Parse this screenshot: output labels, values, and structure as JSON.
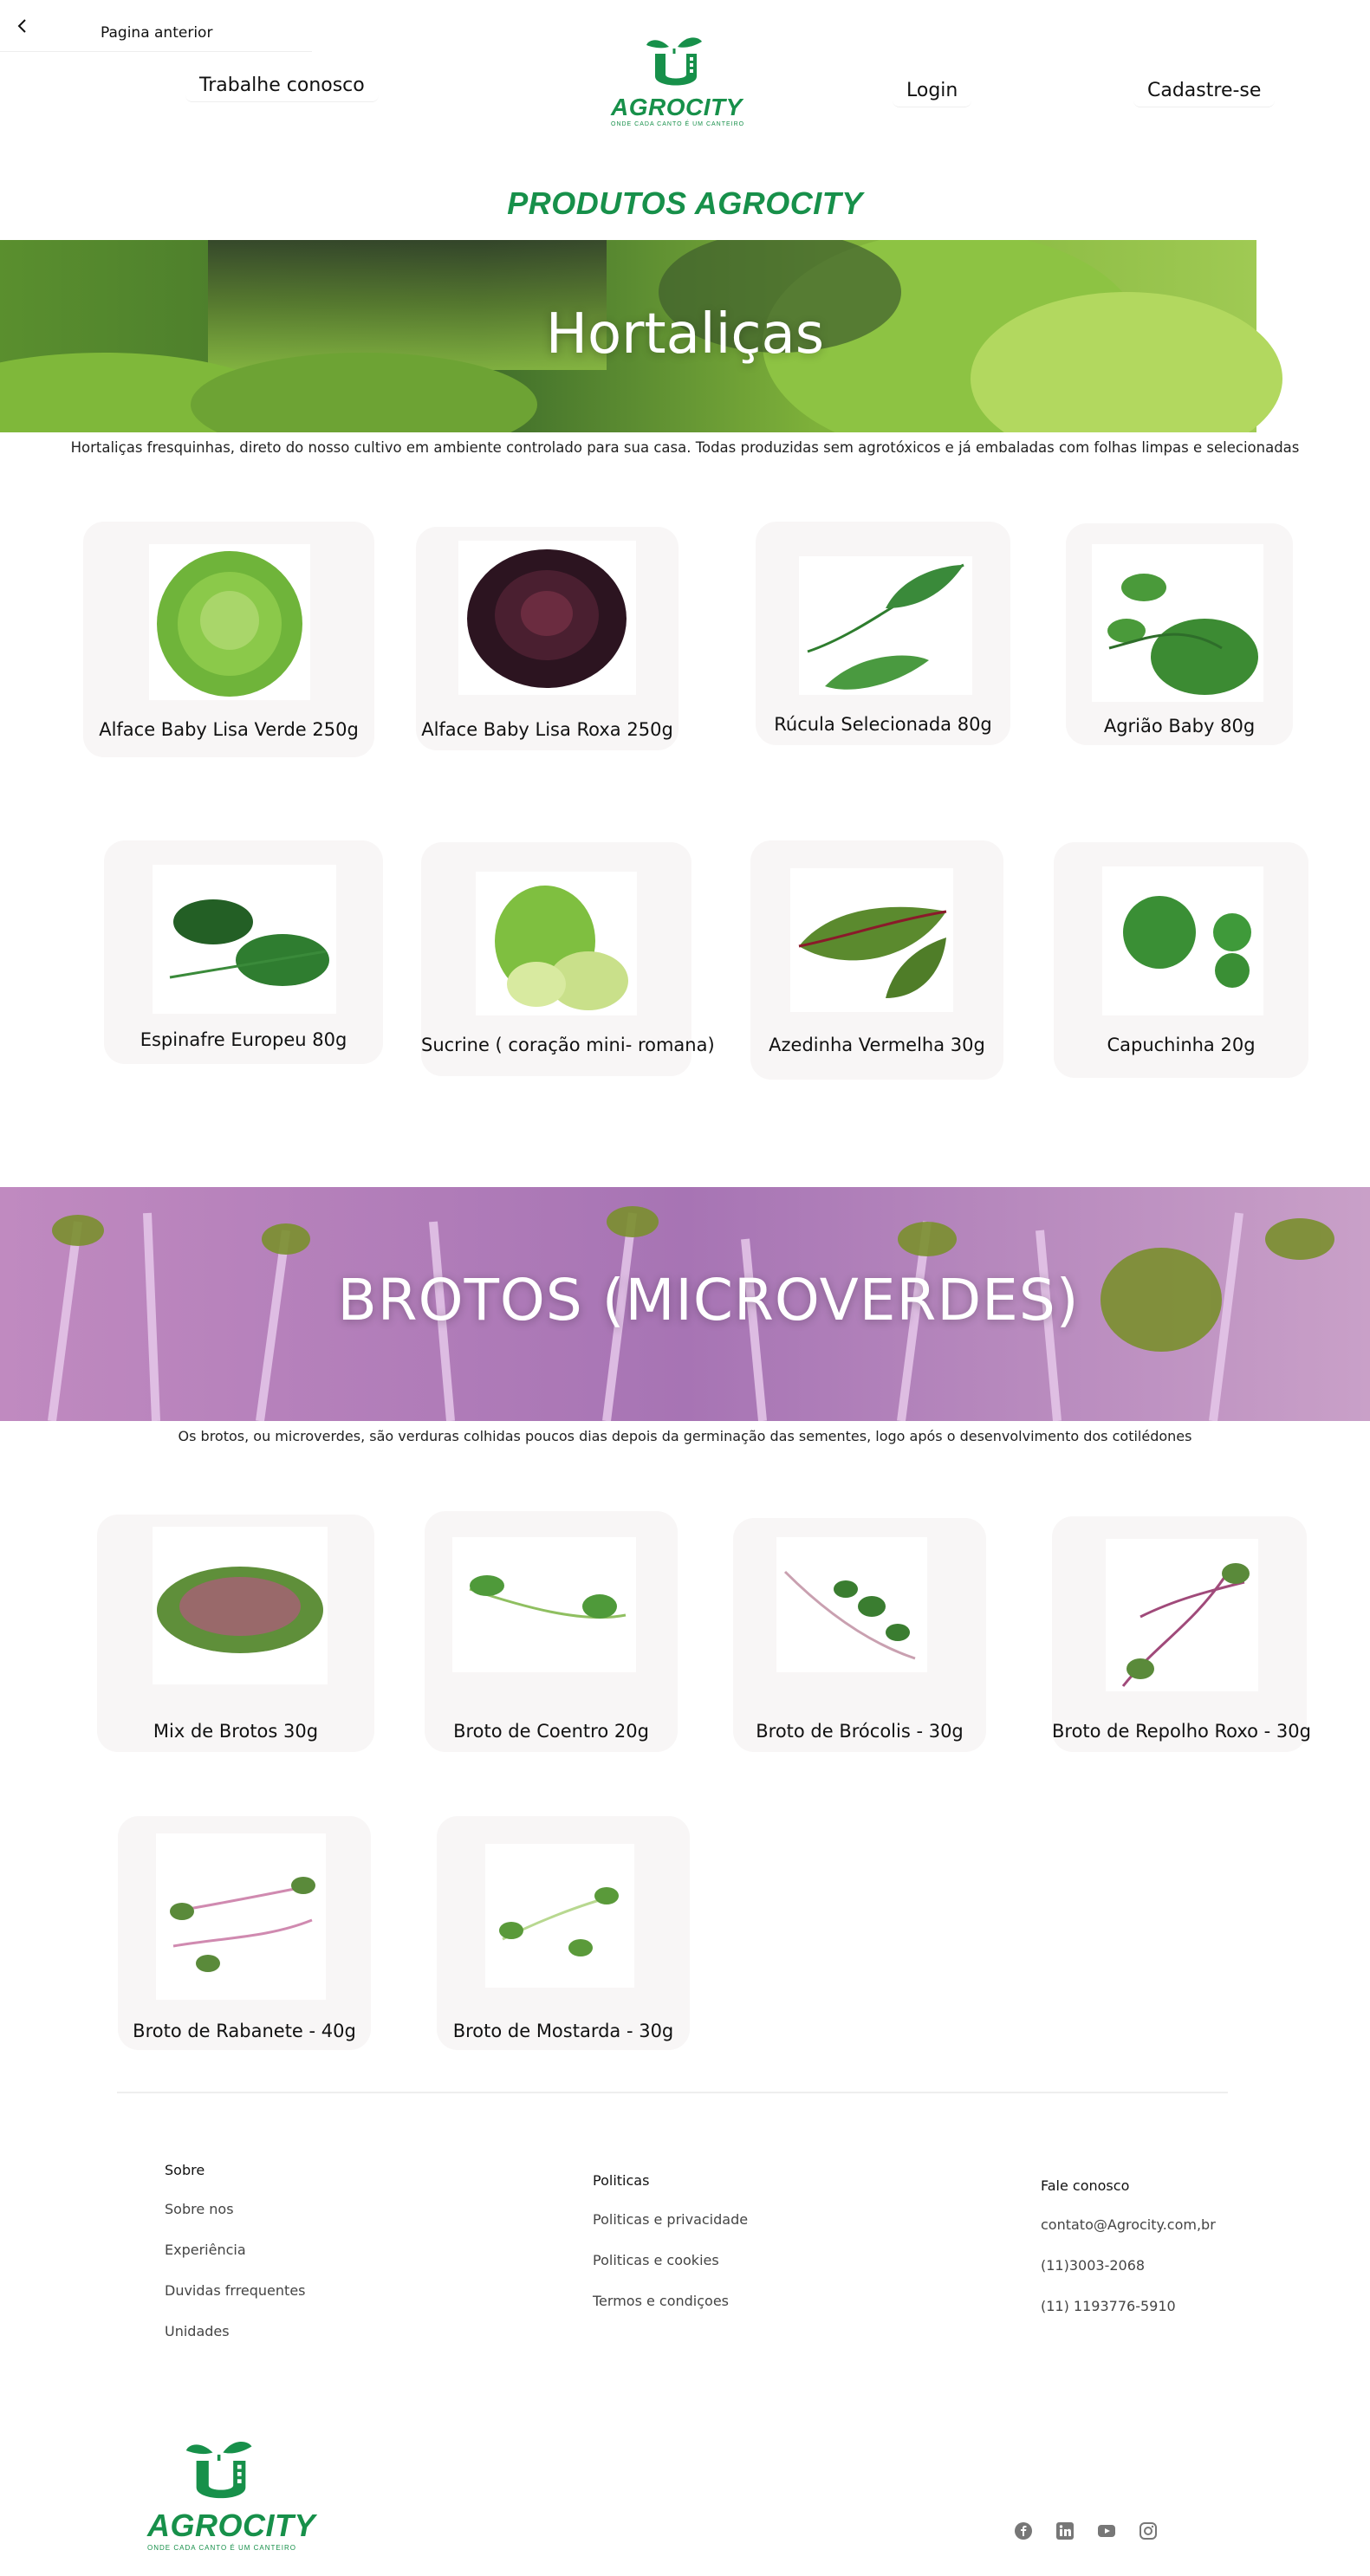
{
  "topbar": {
    "back_label": "Pagina anterior",
    "work_with_us": "Trabalhe conosco",
    "login": "Login",
    "signup": "Cadastre-se"
  },
  "logo": {
    "name": "AGROCITY",
    "tagline": "ONDE CADA CANTO É UM CANTEIRO"
  },
  "page_title": "PRODUTOS AGROCITY",
  "hortalicas": {
    "title": "Hortaliças",
    "description": "Hortaliças fresquinhas, direto do nosso cultivo em ambiente controlado para sua casa. Todas produzidas sem agrotóxicos e já embaladas com folhas limpas e selecionadas",
    "products": [
      {
        "name": "Alface Baby Lisa Verde 250g",
        "icon": "green-lettuce-image"
      },
      {
        "name": "Alface Baby Lisa Roxa 250g",
        "icon": "purple-lettuce-image"
      },
      {
        "name": "Rúcula Selecionada 80g",
        "icon": "arugula-image"
      },
      {
        "name": "Agrião Baby  80g",
        "icon": "watercress-image"
      },
      {
        "name": "Espinafre Europeu 80g",
        "icon": "spinach-image"
      },
      {
        "name": "Sucrine ( coração mini- romana)",
        "icon": "sucrine-image"
      },
      {
        "name": "Azedinha Vermelha  30g",
        "icon": "red-sorrel-image"
      },
      {
        "name": "Capuchinha  20g",
        "icon": "nasturtium-image"
      }
    ]
  },
  "brotos": {
    "title": "BROTOS (MICROVERDES)",
    "description": "Os brotos, ou microverdes, são verduras colhidas poucos dias depois da germinação das sementes, logo após o desenvolvimento dos cotilédones",
    "products": [
      {
        "name": "Mix de Brotos  30g",
        "icon": "sprouts-mix-image"
      },
      {
        "name": "Broto de Coentro 20g",
        "icon": "coriander-sprout-image"
      },
      {
        "name": "Broto de Brócolis - 30g",
        "icon": "broccoli-sprout-image"
      },
      {
        "name": "Broto de Repolho Roxo - 30g",
        "icon": "red-cabbage-sprout-image"
      },
      {
        "name": "Broto de Rabanete - 40g",
        "icon": "radish-sprout-image"
      },
      {
        "name": "Broto de Mostarda - 30g",
        "icon": "mustard-sprout-image"
      }
    ]
  },
  "footer": {
    "col1": {
      "heading": "Sobre",
      "links": [
        "Sobre nos",
        "Experiência",
        "Duvidas frrequentes",
        "Unidades"
      ]
    },
    "col2": {
      "heading": "Politicas",
      "links": [
        "Politicas e privacidade",
        "Politicas e cookies",
        "Termos e condiçoes"
      ]
    },
    "col3": {
      "heading": "Fale conosco",
      "links": [
        "contato@Agrocity.com,br",
        "(11)3003-2068",
        "(11) 1193776-5910"
      ]
    },
    "social_icons": [
      "facebook-icon",
      "linkedin-icon",
      "youtube-icon",
      "instagram-icon"
    ]
  },
  "colors": {
    "brand_green": "#17904a",
    "card_bg": "#f8f6f6"
  }
}
